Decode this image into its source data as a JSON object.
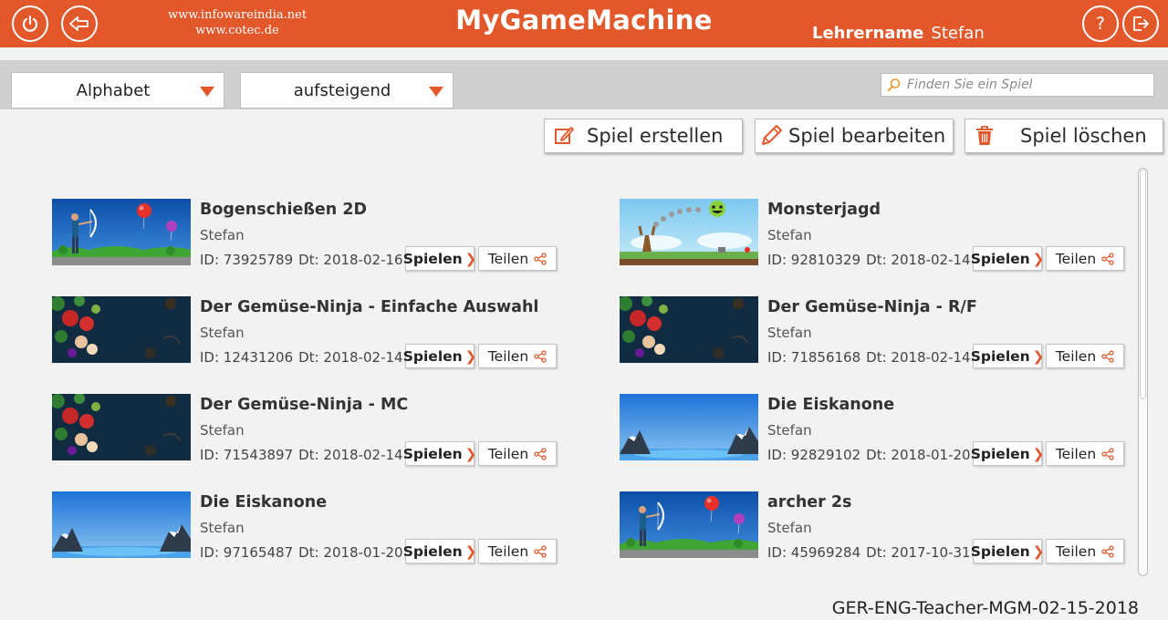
{
  "header": {
    "site_line1": "www.infowareindia.net",
    "site_line2": "www.cotec.de",
    "title": "MyGameMachine",
    "teacher_label": "Lehrername",
    "teacher_name": "Stefan",
    "accent_color": "#e2582a",
    "icons": [
      "power-icon",
      "back-arrow-icon",
      "help-icon",
      "logout-icon"
    ]
  },
  "filters": {
    "sort_by": "Alphabet",
    "order": "aufsteigend",
    "search_placeholder": "Finden Sie ein Spiel"
  },
  "actions": {
    "create": "Spiel erstellen",
    "edit": "Spiel bearbeiten",
    "delete": "Spiel löschen"
  },
  "buttons": {
    "play": "Spielen",
    "share": "Teilen"
  },
  "games": [
    {
      "title": "Bogenschießen 2D",
      "author": "Stefan",
      "id": "ID: 73925789",
      "date": "Dt: 2018-02-16",
      "thumb": "archery"
    },
    {
      "title": "Monsterjagd",
      "author": "Stefan",
      "id": "ID: 92810329",
      "date": "Dt: 2018-02-14",
      "thumb": "monster"
    },
    {
      "title": "Der Gemüse-Ninja - Einfache Auswahl",
      "author": "Stefan",
      "id": "ID: 12431206",
      "date": "Dt: 2018-02-14",
      "thumb": "ninja"
    },
    {
      "title": "Der Gemüse-Ninja - R/F",
      "author": "Stefan",
      "id": "ID: 71856168",
      "date": "Dt: 2018-02-14",
      "thumb": "ninja"
    },
    {
      "title": "Der Gemüse-Ninja - MC",
      "author": "Stefan",
      "id": "ID: 71543897",
      "date": "Dt: 2018-02-14",
      "thumb": "ninja"
    },
    {
      "title": "Die Eiskanone",
      "author": "Stefan",
      "id": "ID: 92829102",
      "date": "Dt: 2018-01-20",
      "thumb": "ice"
    },
    {
      "title": "Die Eiskanone",
      "author": "Stefan",
      "id": "ID: 97165487",
      "date": "Dt: 2018-01-20",
      "thumb": "ice"
    },
    {
      "title": "archer 2s",
      "author": "Stefan",
      "id": "ID: 45969284",
      "date": "Dt: 2017-10-31",
      "thumb": "archery"
    }
  ],
  "footer": {
    "version": "GER-ENG-Teacher-MGM-02-15-2018"
  }
}
